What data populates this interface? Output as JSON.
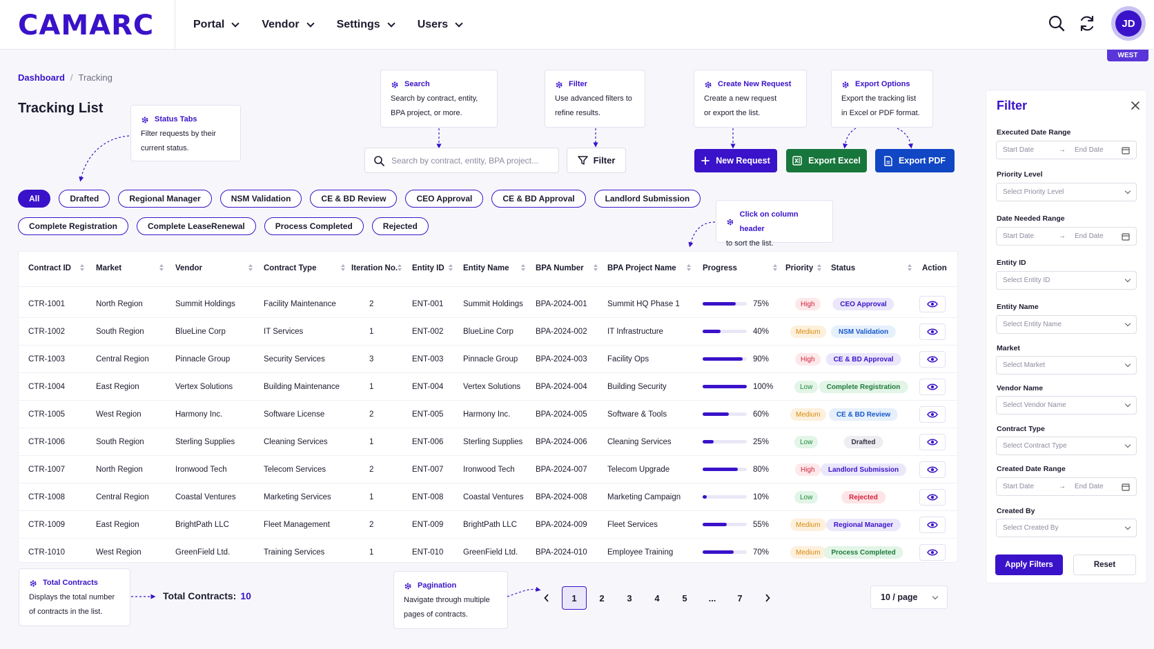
{
  "app": {
    "logo": "CAMARC",
    "nav": [
      "Portal",
      "Vendor",
      "Settings",
      "Users"
    ],
    "user_initials": "JD",
    "region_badge": "WEST"
  },
  "breadcrumb": {
    "root": "Dashboard",
    "separator": "/",
    "current": "Tracking"
  },
  "page_title": "Tracking List",
  "callouts": {
    "status_tabs": {
      "title": "Status Tabs",
      "line1": "Filter requests by their",
      "line2": "current status."
    },
    "search": {
      "title": "Search",
      "line1": "Search by contract, entity,",
      "line2": "BPA project, or more."
    },
    "filter": {
      "title": "Filter",
      "line1": "Use advanced filters to",
      "line2": "refine results."
    },
    "create": {
      "title": "Create New Request",
      "line1": "Create a new request",
      "line2": "or export the list."
    },
    "export": {
      "title": "Export Options",
      "line1": "Export the tracking list",
      "line2": "in Excel or PDF format."
    },
    "sort": {
      "title": "Click on column header",
      "line1": "to sort the list."
    },
    "total": {
      "title": "Total Contracts",
      "line1": "Displays the total number",
      "line2": "of contracts in the list."
    },
    "pagination": {
      "title": "Pagination",
      "line1": "Navigate through multiple",
      "line2": "pages of contracts."
    }
  },
  "toolbar": {
    "search_placeholder": "Search by contract, entity, BPA project...",
    "filter_label": "Filter",
    "new_request_label": "New Request",
    "export_excel_label": "Export Excel",
    "export_pdf_label": "Export PDF"
  },
  "status_tabs": {
    "row1": [
      "All",
      "Drafted",
      "Regional Manager",
      "NSM Validation",
      "CE & BD Review",
      "CEO Approval",
      "CE & BD Approval",
      "Landlord Submission"
    ],
    "row2": [
      "Complete Registration",
      "Complete LeaseRenewal",
      "Process Completed",
      "Rejected"
    ],
    "active": "All"
  },
  "table": {
    "columns": [
      "Contract ID",
      "Market",
      "Vendor",
      "Contract Type",
      "Iteration No.",
      "Entity ID",
      "Entity Name",
      "BPA Number",
      "BPA Project Name",
      "Progress",
      "Priority",
      "Status",
      "Action"
    ],
    "rows": [
      {
        "contract_id": "CTR-1001",
        "market": "North Region",
        "vendor": "Summit Holdings",
        "contract_type": "Facility Maintenance",
        "iteration": "2",
        "entity_id": "ENT-001",
        "entity_name": "Summit Holdings",
        "bpa_number": "BPA-2024-001",
        "bpa_project": "Summit HQ Phase 1",
        "progress": 75,
        "progress_label": "75%",
        "priority": "High",
        "status": "CEO Approval"
      },
      {
        "contract_id": "CTR-1002",
        "market": "South Region",
        "vendor": "BlueLine Corp",
        "contract_type": "IT Services",
        "iteration": "1",
        "entity_id": "ENT-002",
        "entity_name": "BlueLine Corp",
        "bpa_number": "BPA-2024-002",
        "bpa_project": "IT Infrastructure",
        "progress": 40,
        "progress_label": "40%",
        "priority": "Medium",
        "status": "NSM Validation"
      },
      {
        "contract_id": "CTR-1003",
        "market": "Central Region",
        "vendor": "Pinnacle Group",
        "contract_type": "Security Services",
        "iteration": "3",
        "entity_id": "ENT-003",
        "entity_name": "Pinnacle Group",
        "bpa_number": "BPA-2024-003",
        "bpa_project": "Facility Ops",
        "progress": 90,
        "progress_label": "90%",
        "priority": "High",
        "status": "CE & BD Approval"
      },
      {
        "contract_id": "CTR-1004",
        "market": "East Region",
        "vendor": "Vertex Solutions",
        "contract_type": "Building Maintenance",
        "iteration": "1",
        "entity_id": "ENT-004",
        "entity_name": "Vertex Solutions",
        "bpa_number": "BPA-2024-004",
        "bpa_project": "Building Security",
        "progress": 100,
        "progress_label": "100%",
        "priority": "Low",
        "status": "Complete Registration"
      },
      {
        "contract_id": "CTR-1005",
        "market": "West Region",
        "vendor": "Harmony Inc.",
        "contract_type": "Software License",
        "iteration": "2",
        "entity_id": "ENT-005",
        "entity_name": "Harmony Inc.",
        "bpa_number": "BPA-2024-005",
        "bpa_project": "Software & Tools",
        "progress": 60,
        "progress_label": "60%",
        "priority": "Medium",
        "status": "CE & BD Review"
      },
      {
        "contract_id": "CTR-1006",
        "market": "South Region",
        "vendor": "Sterling Supplies",
        "contract_type": "Cleaning Services",
        "iteration": "1",
        "entity_id": "ENT-006",
        "entity_name": "Sterling Supplies",
        "bpa_number": "BPA-2024-006",
        "bpa_project": "Cleaning Services",
        "progress": 25,
        "progress_label": "25%",
        "priority": "Low",
        "status": "Drafted"
      },
      {
        "contract_id": "CTR-1007",
        "market": "North Region",
        "vendor": "Ironwood Tech",
        "contract_type": "Telecom Services",
        "iteration": "2",
        "entity_id": "ENT-007",
        "entity_name": "Ironwood Tech",
        "bpa_number": "BPA-2024-007",
        "bpa_project": "Telecom Upgrade",
        "progress": 80,
        "progress_label": "80%",
        "priority": "High",
        "status": "Landlord Submission"
      },
      {
        "contract_id": "CTR-1008",
        "market": "Central Region",
        "vendor": "Coastal Ventures",
        "contract_type": "Marketing Services",
        "iteration": "1",
        "entity_id": "ENT-008",
        "entity_name": "Coastal Ventures",
        "bpa_number": "BPA-2024-008",
        "bpa_project": "Marketing Campaign",
        "progress": 10,
        "progress_label": "10%",
        "priority": "Low",
        "status": "Rejected"
      },
      {
        "contract_id": "CTR-1009",
        "market": "East Region",
        "vendor": "BrightPath LLC",
        "contract_type": "Fleet Management",
        "iteration": "2",
        "entity_id": "ENT-009",
        "entity_name": "BrightPath LLC",
        "bpa_number": "BPA-2024-009",
        "bpa_project": "Fleet Services",
        "progress": 55,
        "progress_label": "55%",
        "priority": "Medium",
        "status": "Regional Manager"
      },
      {
        "contract_id": "CTR-1010",
        "market": "West Region",
        "vendor": "GreenField Ltd.",
        "contract_type": "Training Services",
        "iteration": "1",
        "entity_id": "ENT-010",
        "entity_name": "GreenField Ltd.",
        "bpa_number": "BPA-2024-010",
        "bpa_project": "Employee Training",
        "progress": 70,
        "progress_label": "70%",
        "priority": "Medium",
        "status": "Process Completed"
      }
    ]
  },
  "status_colors": {
    "CEO Approval": {
      "bg": "#ebe7fb",
      "fg": "#3a12c9"
    },
    "NSM Validation": {
      "bg": "#e6f0fd",
      "fg": "#1658c9"
    },
    "CE & BD Approval": {
      "bg": "#ebe7fb",
      "fg": "#3a12c9"
    },
    "Complete Registration": {
      "bg": "#e2f5e7",
      "fg": "#1f7a3a"
    },
    "CE & BD Review": {
      "bg": "#e6f0fd",
      "fg": "#1658c9"
    },
    "Drafted": {
      "bg": "#eeeef2",
      "fg": "#333344"
    },
    "Landlord Submission": {
      "bg": "#ebe7fb",
      "fg": "#3a12c9"
    },
    "Rejected": {
      "bg": "#fde4e6",
      "fg": "#d3223a"
    },
    "Regional Manager": {
      "bg": "#ebe7fb",
      "fg": "#3a12c9"
    },
    "Process Completed": {
      "bg": "#e2f5e7",
      "fg": "#1f7a3a"
    }
  },
  "footer": {
    "total_label": "Total Contracts:",
    "total_value": "10",
    "pages": [
      "1",
      "2",
      "3",
      "4",
      "5",
      "...",
      "7"
    ],
    "current_page": "1",
    "per_page": "10 / page"
  },
  "filter_panel": {
    "title": "Filter",
    "executed_date_label": "Executed Date Range",
    "priority_label": "Priority Level",
    "priority_placeholder": "Select Priority Level",
    "date_needed_label": "Date Needed Range",
    "entity_id_label": "Entity ID",
    "entity_id_placeholder": "Select Entity ID",
    "entity_name_label": "Entity Name",
    "entity_name_placeholder": "Select Entity Name",
    "market_label": "Market",
    "market_placeholder": "Select Market",
    "vendor_label": "Vendor Name",
    "vendor_placeholder": "Select Vendor Name",
    "contract_type_label": "Contract Type",
    "contract_type_placeholder": "Select Contract Type",
    "created_date_label": "Created Date Range",
    "created_by_label": "Created By",
    "created_by_placeholder": "Select Created By",
    "start_date": "Start Date",
    "end_date": "End Date",
    "apply_label": "Apply Filters",
    "reset_label": "Reset"
  },
  "colors": {
    "primary": "#3a12c9",
    "excel": "#17763b",
    "pdf": "#1146c4"
  }
}
